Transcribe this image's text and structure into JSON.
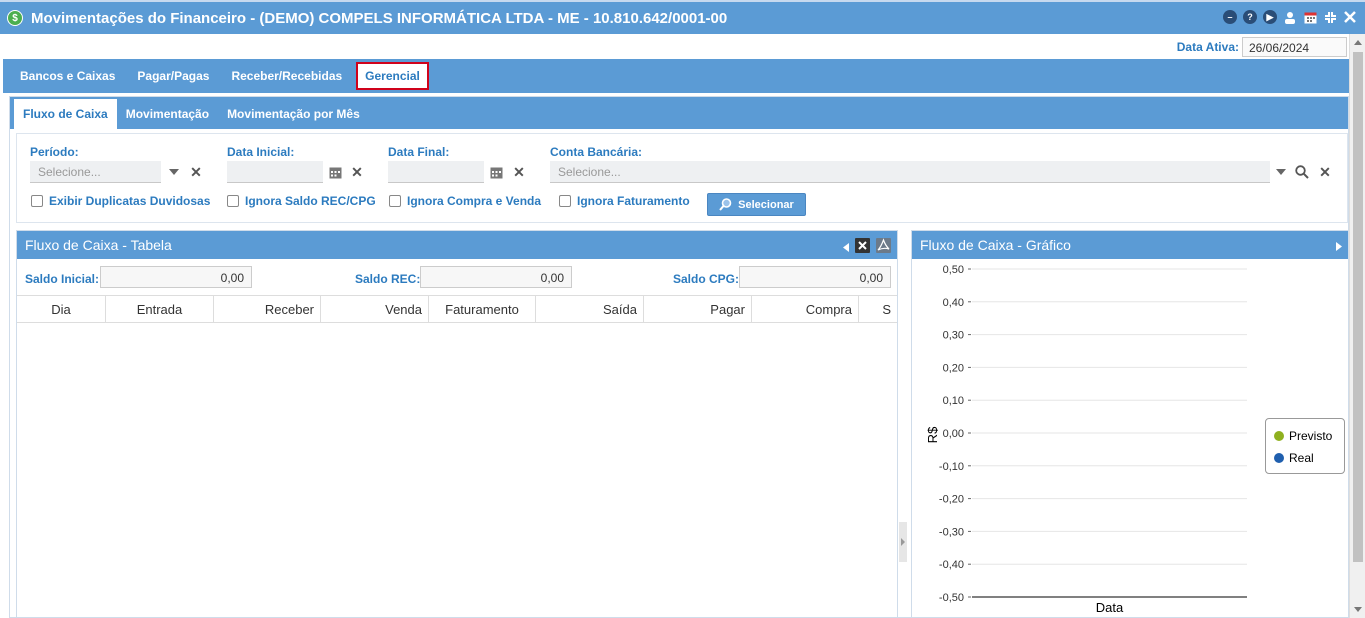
{
  "window": {
    "title": "Movimentações do Financeiro - (DEMO) COMPELS INFORMÁTICA LTDA - ME - 10.810.642/0001-00",
    "logo_glyph": "$",
    "icons": [
      "minimize-circle-icon",
      "help-circle-icon",
      "play-circle-icon",
      "user-icon",
      "calendar-icon",
      "collapse-icon",
      "close-icon"
    ]
  },
  "active_date": {
    "label": "Data Ativa:",
    "value": "26/06/2024"
  },
  "main_tabs": [
    {
      "label": "Bancos e Caixas"
    },
    {
      "label": "Pagar/Pagas"
    },
    {
      "label": "Receber/Recebidas"
    },
    {
      "label": "Gerencial",
      "active": true
    }
  ],
  "sub_tabs": [
    {
      "label": "Fluxo de Caixa",
      "active": true
    },
    {
      "label": "Movimentação"
    },
    {
      "label": "Movimentação por Mês"
    }
  ],
  "filters": {
    "periodo": {
      "label": "Período:",
      "placeholder": "Selecione..."
    },
    "data_inicial": {
      "label": "Data Inicial:",
      "value": ""
    },
    "data_final": {
      "label": "Data Final:",
      "value": ""
    },
    "conta": {
      "label": "Conta Bancária:",
      "placeholder": "Selecione..."
    },
    "checkboxes": [
      {
        "label": "Exibir Duplicatas Duvidosas",
        "checked": false
      },
      {
        "label": "Ignora Saldo REC/CPG",
        "checked": false
      },
      {
        "label": "Ignora Compra e Venda",
        "checked": false
      },
      {
        "label": "Ignora Faturamento",
        "checked": false
      }
    ],
    "select_button": "Selecionar"
  },
  "table_panel": {
    "title": "Fluxo de Caixa - Tabela",
    "saldo_inicial": {
      "label": "Saldo Inicial:",
      "value": "0,00"
    },
    "saldo_rec": {
      "label": "Saldo REC:",
      "value": "0,00"
    },
    "saldo_cpg": {
      "label": "Saldo CPG:",
      "value": "0,00"
    },
    "columns": [
      "Dia",
      "Entrada",
      "Receber",
      "Venda",
      "Faturamento",
      "Saída",
      "Pagar",
      "Compra",
      "S"
    ]
  },
  "chart_panel": {
    "title": "Fluxo de Caixa - Gráfico",
    "chart_data": {
      "type": "line",
      "xlabel": "Data",
      "ylabel": "R$",
      "ylim": [
        -0.5,
        0.5
      ],
      "yticks": [
        "0,50",
        "0,40",
        "0,30",
        "0,20",
        "0,10",
        "0,00",
        "-0,10",
        "-0,20",
        "-0,30",
        "-0,40",
        "-0,50"
      ],
      "grid": true,
      "legend": "right",
      "series": [
        {
          "name": "Previsto",
          "color": "#8fb01f",
          "values": []
        },
        {
          "name": "Real",
          "color": "#1f5fae",
          "values": []
        }
      ]
    }
  }
}
